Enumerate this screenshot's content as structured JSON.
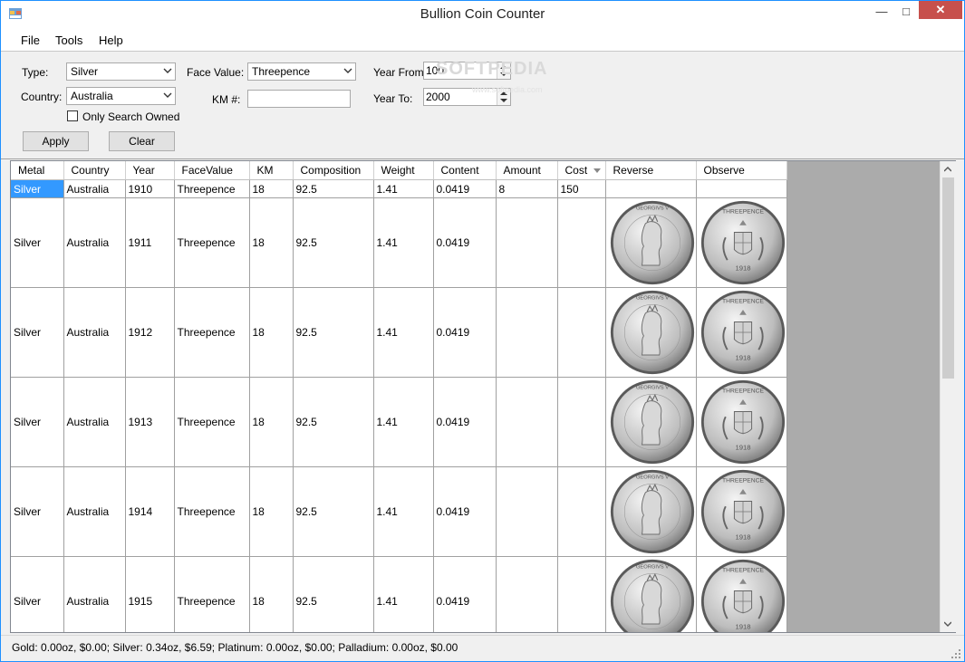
{
  "window": {
    "title": "Bullion Coin Counter",
    "minimize": "—",
    "maximize": "□",
    "close": "✕"
  },
  "menu": [
    "File",
    "Tools",
    "Help"
  ],
  "filters": {
    "type_label": "Type:",
    "type_value": "Silver",
    "country_label": "Country:",
    "country_value": "Australia",
    "only_owned_label": "Only Search Owned",
    "only_owned_checked": false,
    "face_value_label": "Face Value:",
    "face_value_value": "Threepence",
    "km_label": "KM #:",
    "km_value": "",
    "year_from_label": "Year From:",
    "year_from_value": "100",
    "year_to_label": "Year To:",
    "year_to_value": "2000",
    "apply_label": "Apply",
    "clear_label": "Clear",
    "watermark": "SOFTPEDIA",
    "watermark_url": "www.softpedia.com"
  },
  "grid": {
    "columns": [
      "Metal",
      "Country",
      "Year",
      "FaceValue",
      "KM",
      "Composition",
      "Weight",
      "Content",
      "Amount",
      "Cost",
      "Reverse",
      "Observe"
    ],
    "rows": [
      {
        "metal": "Silver",
        "country": "Australia",
        "year": "1910",
        "face": "Threepence",
        "km": "18",
        "comp": "92.5",
        "weight": "1.41",
        "content": "0.0419",
        "amount": "8",
        "cost": "150"
      },
      {
        "metal": "Silver",
        "country": "Australia",
        "year": "1911",
        "face": "Threepence",
        "km": "18",
        "comp": "92.5",
        "weight": "1.41",
        "content": "0.0419",
        "amount": "",
        "cost": ""
      },
      {
        "metal": "Silver",
        "country": "Australia",
        "year": "1912",
        "face": "Threepence",
        "km": "18",
        "comp": "92.5",
        "weight": "1.41",
        "content": "0.0419",
        "amount": "",
        "cost": ""
      },
      {
        "metal": "Silver",
        "country": "Australia",
        "year": "1913",
        "face": "Threepence",
        "km": "18",
        "comp": "92.5",
        "weight": "1.41",
        "content": "0.0419",
        "amount": "",
        "cost": ""
      },
      {
        "metal": "Silver",
        "country": "Australia",
        "year": "1914",
        "face": "Threepence",
        "km": "18",
        "comp": "92.5",
        "weight": "1.41",
        "content": "0.0419",
        "amount": "",
        "cost": ""
      },
      {
        "metal": "Silver",
        "country": "Australia",
        "year": "1915",
        "face": "Threepence",
        "km": "18",
        "comp": "92.5",
        "weight": "1.41",
        "content": "0.0419",
        "amount": "",
        "cost": ""
      }
    ],
    "coin_reverse_text": "GEORGIVS V D.G.BRITT: OMN:REX",
    "coin_observe_text": "THREEPENCE",
    "coin_observe_year": "1918"
  },
  "status": "Gold: 0.00oz, $0.00; Silver: 0.34oz, $6.59; Platinum: 0.00oz, $0.00; Palladium: 0.00oz, $0.00"
}
